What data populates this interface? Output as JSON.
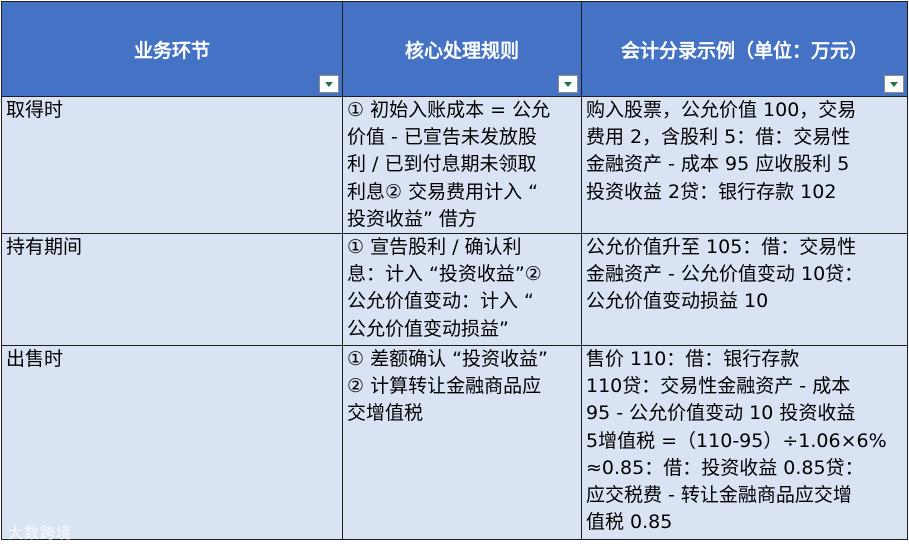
{
  "headers": [
    {
      "label": "业务环节"
    },
    {
      "label": "核心处理规则"
    },
    {
      "label": "会计分录示例（单位：万元）"
    }
  ],
  "rows": [
    {
      "stage": "取得时",
      "rule_lines": [
        "① 初始入账成本 = 公允",
        "价值 - 已宣告未发放股",
        "利 / 已到付息期未领取",
        "利息② 交易费用计入 “",
        "投资收益” 借方"
      ],
      "entry_lines": [
        "购入股票，公允价值 100，交易",
        "费用 2，含股利 5：借：交易性",
        "金融资产 - 成本 95  应收股利 5",
        "投资收益 2贷：银行存款 102"
      ]
    },
    {
      "stage": "持有期间",
      "rule_lines": [
        "① 宣告股利 / 确认利",
        "息：计入 “投资收益”②",
        "公允价值变动：计入 “",
        "公允价值变动损益”"
      ],
      "entry_lines": [
        "公允价值升至 105：借：交易性",
        "金融资产 - 公允价值变动 10贷：",
        "公允价值变动损益 10"
      ]
    },
    {
      "stage": "出售时",
      "rule_lines": [
        "① 差额确认 “投资收益”",
        "② 计算转让金融商品应",
        "交增值税"
      ],
      "entry_lines": [
        "售价 110：借：银行存款",
        "110贷：交易性金融资产 - 成本",
        "95  - 公允价值变动 10  投资收益",
        "5增值税 =（110-95）÷1.06×6%",
        "≈0.85：借：投资收益 0.85贷：",
        "应交税费 - 转让金融商品应交增",
        "值税 0.85"
      ]
    }
  ],
  "watermark": "大数跨境",
  "colors": {
    "header_bg": "#4472c4",
    "cell_bg": "#dae3f3",
    "filter_arrow": "#217346"
  },
  "icons": {
    "filter": "filter-dropdown-icon"
  }
}
